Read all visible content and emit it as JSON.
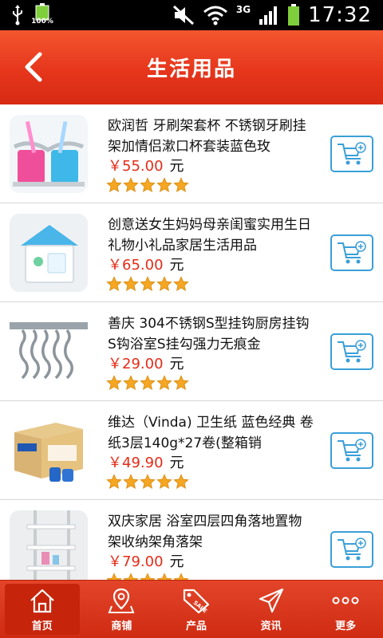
{
  "status_bar": {
    "battery_small_label": "100%",
    "network": "3G",
    "time": "17:32"
  },
  "header": {
    "title": "生活用品"
  },
  "products": [
    {
      "name": "欧润哲 牙刷架套杯 不锈钢牙刷挂架加情侣漱口杯套装蓝色玫",
      "price": "￥55.00",
      "unit": "元",
      "rating": 5
    },
    {
      "name": "创意送女生妈妈母亲闺蜜实用生日礼物小礼品家居生活用品",
      "price": "￥65.00",
      "unit": "元",
      "rating": 5
    },
    {
      "name": "善庆 304不锈钢S型挂钩厨房挂钩S钩浴室S挂勾强力无痕金",
      "price": "￥29.00",
      "unit": "元",
      "rating": 5
    },
    {
      "name": "维达（Vinda) 卫生纸 蓝色经典 卷纸3层140g*27卷(整箱销",
      "price": "￥49.90",
      "unit": "元",
      "rating": 5
    },
    {
      "name": "双庆家居 浴室四层四角落地置物架收纳架角落架",
      "price": "￥79.00",
      "unit": "元",
      "rating": 5
    }
  ],
  "nav": [
    {
      "label": "首页",
      "icon": "home-icon",
      "active": true
    },
    {
      "label": "商铺",
      "icon": "map-pin-icon",
      "active": false
    },
    {
      "label": "产品",
      "icon": "sale-tag-icon",
      "active": false
    },
    {
      "label": "资讯",
      "icon": "send-icon",
      "active": false
    },
    {
      "label": "更多",
      "icon": "more-icon",
      "active": false
    }
  ],
  "colors": {
    "header_red": "#e6361c",
    "price_red": "#e52b17",
    "cart_blue": "#3a9fd8",
    "star_orange": "#f5a623"
  }
}
